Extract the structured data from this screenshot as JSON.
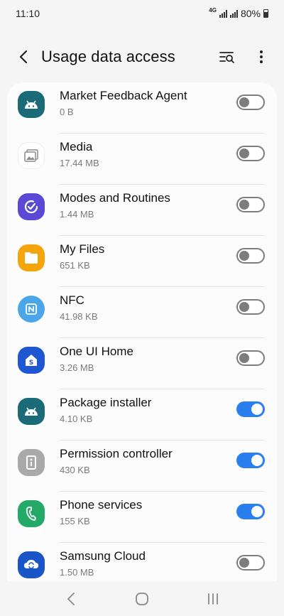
{
  "status_bar": {
    "time": "11:10",
    "network": "4G",
    "battery_pct": "80%",
    "battery_level": 0.8
  },
  "header": {
    "title": "Usage data access",
    "back_icon": "back-arrow-icon",
    "search_icon": "filter-search-icon",
    "more_icon": "more-options-icon"
  },
  "apps": [
    {
      "name": "Market Feedback Agent",
      "size": "0 B",
      "enabled": false,
      "icon": "android-icon",
      "color": "#1b6a78"
    },
    {
      "name": "Media",
      "size": "17.44 MB",
      "enabled": false,
      "icon": "gallery-icon",
      "color": "#ffffff"
    },
    {
      "name": "Modes and Routines",
      "size": "1.44 MB",
      "enabled": false,
      "icon": "check-circle-icon",
      "color": "#5b49d6"
    },
    {
      "name": "My Files",
      "size": "651 KB",
      "enabled": false,
      "icon": "folder-icon",
      "color": "#f5a50c"
    },
    {
      "name": "NFC",
      "size": "41.98 KB",
      "enabled": false,
      "icon": "nfc-icon",
      "color": "#4aa6e8"
    },
    {
      "name": "One UI Home",
      "size": "3.26 MB",
      "enabled": false,
      "icon": "home-s-icon",
      "color": "#1f56d2"
    },
    {
      "name": "Package installer",
      "size": "4.10 KB",
      "enabled": true,
      "icon": "android-icon",
      "color": "#1b6a78"
    },
    {
      "name": "Permission controller",
      "size": "430 KB",
      "enabled": true,
      "icon": "info-icon",
      "color": "#a9a9a9"
    },
    {
      "name": "Phone services",
      "size": "155 KB",
      "enabled": true,
      "icon": "phone-icon",
      "color": "#25a969"
    },
    {
      "name": "Samsung Cloud",
      "size": "1.50 MB",
      "enabled": false,
      "icon": "cloud-sync-icon",
      "color": "#1a55c8"
    }
  ],
  "nav_bar": {
    "recents_icon": "recents-icon",
    "home_icon": "home-icon",
    "back_icon": "back-icon"
  }
}
